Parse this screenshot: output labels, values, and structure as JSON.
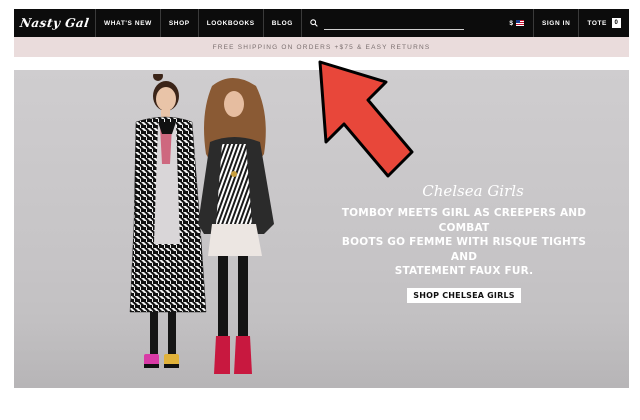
{
  "logo": {
    "text": "Nasty Gal"
  },
  "nav": {
    "items": [
      {
        "label": "WHAT'S NEW"
      },
      {
        "label": "SHOP"
      },
      {
        "label": "LOOKBOOKS"
      },
      {
        "label": "BLOG"
      }
    ],
    "search_value": "",
    "currency_symbol": "$",
    "flag_icon": "us-flag-icon",
    "sign_in_label": "SIGN IN",
    "tote_label": "TOTE",
    "tote_count": "0"
  },
  "promo": {
    "text": "FREE SHIPPING ON ORDERS +$75 & EASY RETURNS"
  },
  "hero": {
    "subtitle": "Chelsea Girls",
    "headline_lines": [
      "TOMBOY MEETS GIRL AS CREEPERS AND COMBAT",
      "BOOTS GO FEMME WITH RISQUE TIGHTS AND",
      "STATEMENT FAUX FUR."
    ],
    "cta_label": "SHOP CHELSEA GIRLS"
  },
  "annotation": {
    "arrow_color": "#e8473a",
    "arrow_outline": "#000000"
  }
}
